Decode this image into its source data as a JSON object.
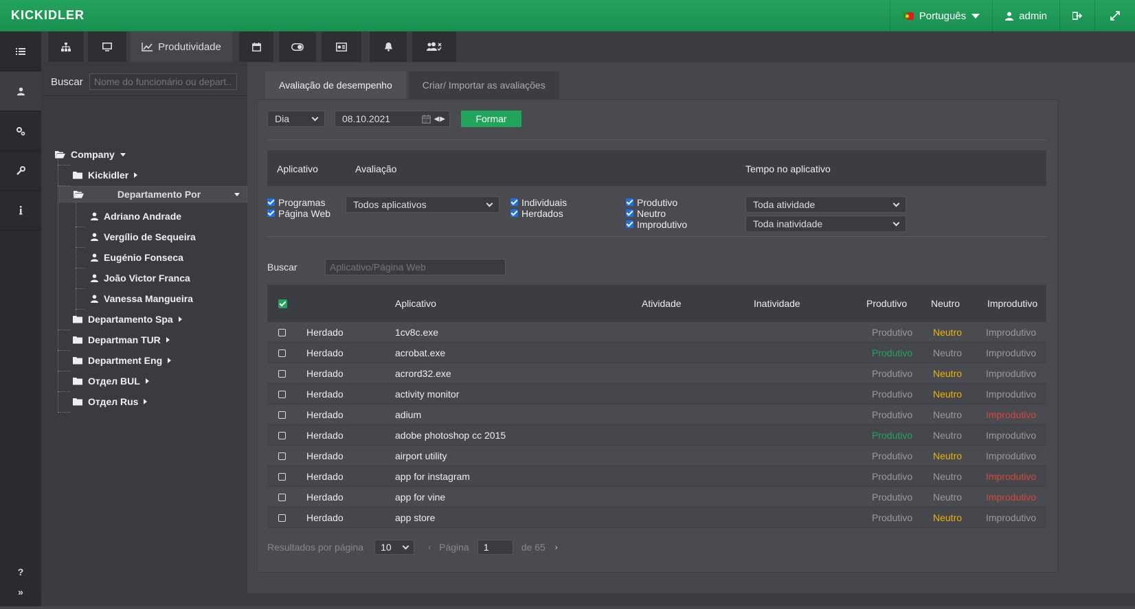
{
  "app": {
    "logo": "KICKIDLER"
  },
  "topbar": {
    "language": "Português",
    "user": "admin"
  },
  "tabs": {
    "productivity_label": "Produtividade"
  },
  "sidebar": {
    "search_label": "Buscar",
    "search_placeholder": "Nome do funcionário ou depart...",
    "tree": {
      "root": "Company",
      "items": [
        "Kickidler",
        "Departamento Por",
        "Adriano Andrade",
        "Vergílio de Sequeira",
        "Eugénio Fonseca",
        "João Victor Franca",
        "Vanessa Mangueira",
        "Departamento Spa",
        "Departman TUR",
        "Department Eng",
        "Отдел BUL",
        "Отдел Rus"
      ]
    }
  },
  "subtabs": [
    "Avaliação de desempenho",
    "Criar/ Importar as avaliações"
  ],
  "form": {
    "period": "Dia",
    "date": "08.10.2021",
    "submit": "Formar"
  },
  "filters": {
    "headers": [
      "Aplicativo",
      "Avaliação",
      "Tempo no aplicativo"
    ],
    "app_types": [
      "Programas",
      "Página Web"
    ],
    "app_select": "Todos aplicativos",
    "sources": [
      "Individuais",
      "Herdados"
    ],
    "ratings": [
      "Produtivo",
      "Neutro",
      "Improdutivo"
    ],
    "activity_select": "Toda atividade",
    "inactivity_select": "Toda inatividade"
  },
  "search2": {
    "label": "Buscar",
    "placeholder": "Aplicativo/Página Web"
  },
  "table": {
    "headers": [
      "Aplicativo",
      "Atividade",
      "Inatividade",
      "Produtivo",
      "Neutro",
      "Improdutivo"
    ],
    "rows": [
      {
        "source": "Herdado",
        "app": "1cv8c.exe",
        "rating": "Neutro",
        "p": "Produtivo",
        "n": "Neutro",
        "i": "Improdutivo"
      },
      {
        "source": "Herdado",
        "app": "acrobat.exe",
        "rating": "Produtivo",
        "p": "Produtivo",
        "n": "Neutro",
        "i": "Improdutivo"
      },
      {
        "source": "Herdado",
        "app": "acrord32.exe",
        "rating": "Neutro",
        "p": "Produtivo",
        "n": "Neutro",
        "i": "Improdutivo"
      },
      {
        "source": "Herdado",
        "app": "activity monitor",
        "rating": "Neutro",
        "p": "Produtivo",
        "n": "Neutro",
        "i": "Improdutivo"
      },
      {
        "source": "Herdado",
        "app": "adium",
        "rating": "Improdutivo",
        "p": "Produtivo",
        "n": "Neutro",
        "i": "Improdutivo"
      },
      {
        "source": "Herdado",
        "app": "adobe photoshop cc 2015",
        "rating": "Produtivo",
        "p": "Produtivo",
        "n": "Neutro",
        "i": "Improdutivo"
      },
      {
        "source": "Herdado",
        "app": "airport utility",
        "rating": "Neutro",
        "p": "Produtivo",
        "n": "Neutro",
        "i": "Improdutivo"
      },
      {
        "source": "Herdado",
        "app": "app for instagram",
        "rating": "Improdutivo",
        "p": "Produtivo",
        "n": "Neutro",
        "i": "Improdutivo"
      },
      {
        "source": "Herdado",
        "app": "app for vine",
        "rating": "Improdutivo",
        "p": "Produtivo",
        "n": "Neutro",
        "i": "Improdutivo"
      },
      {
        "source": "Herdado",
        "app": "app store",
        "rating": "Neutro",
        "p": "Produtivo",
        "n": "Neutro",
        "i": "Improdutivo"
      }
    ]
  },
  "pager": {
    "per_page_label": "Resultados por página",
    "per_page": "10",
    "page_label": "Página",
    "page": "1",
    "of_label": "de 65"
  },
  "colors": {
    "green": "#21a55b",
    "yellow": "#f0b400",
    "red": "#d9453b",
    "gray": "#9a9a9a"
  }
}
